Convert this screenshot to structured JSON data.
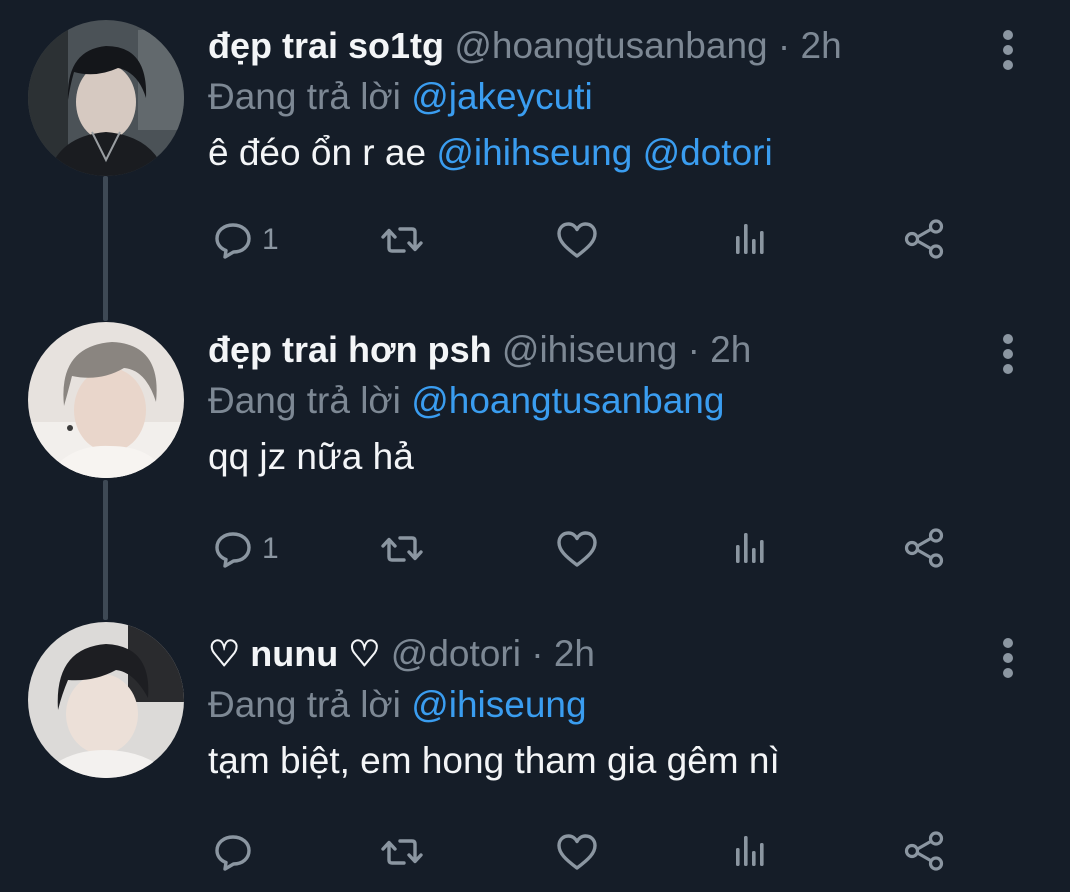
{
  "tweets": [
    {
      "display_name": "đẹp trai so1tg",
      "handle": "@hoangtusanbang",
      "separator": "·",
      "time": "2h",
      "reply_prefix": "Đang trả lời",
      "reply_to": "@jakeycuti",
      "body_text": "ê đéo ổn r ae",
      "body_mentions": "@ihihseung @dotori",
      "reply_count": "1",
      "avatar": "user-photo-dark-hair"
    },
    {
      "display_name": "đẹp trai hơn psh",
      "handle": "@ihiseung",
      "separator": "·",
      "time": "2h",
      "reply_prefix": "Đang trả lời",
      "reply_to": "@hoangtusanbang",
      "body_text": "qq jz nữa hả",
      "body_mentions": "",
      "reply_count": "1",
      "avatar": "user-photo-silver-hair"
    },
    {
      "display_name": "♡ nunu ♡",
      "handle": "@dotori",
      "separator": "·",
      "time": "2h",
      "reply_prefix": "Đang trả lời",
      "reply_to": "@ihiseung",
      "body_text": "tạm biệt, em hong tham gia gêm nì",
      "body_mentions": "",
      "reply_count": "",
      "avatar": "user-photo-selfie"
    }
  ],
  "action_icons": [
    "reply-icon",
    "retweet-icon",
    "like-icon",
    "analytics-icon",
    "share-icon"
  ],
  "colors": {
    "background": "#151d28",
    "text_primary": "#f3f5f7",
    "text_secondary": "#7d8894",
    "mention": "#3a9df0",
    "thread_line": "#3e4955",
    "icon": "#8b96a1"
  }
}
